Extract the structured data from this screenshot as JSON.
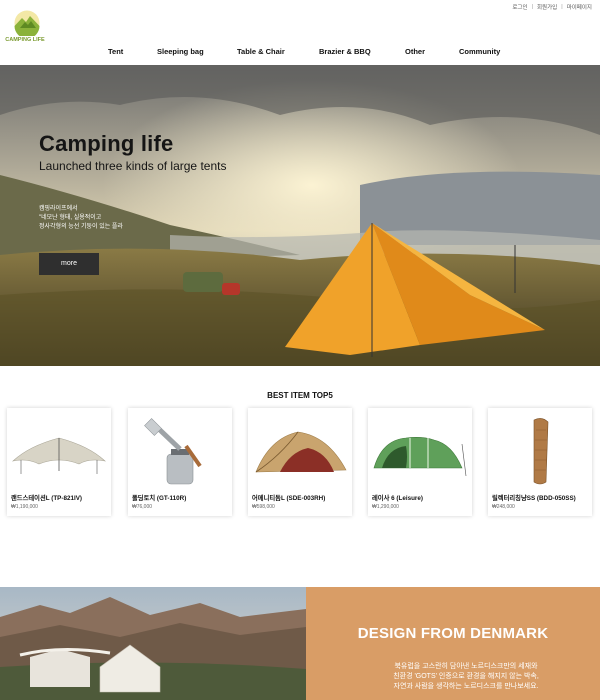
{
  "header": {
    "util_links": [
      "로그인",
      "회원가입",
      "마이페이지"
    ],
    "logo_text": "CAMPING LIFE",
    "nav": [
      "Tent",
      "Sleeping bag",
      "Table & Chair",
      "Brazier & BBQ",
      "Other",
      "Community"
    ]
  },
  "hero": {
    "title": "Camping life",
    "subtitle": "Launched three kinds of large tents",
    "desc_1": "캠핑라이프에서",
    "desc_2": "\"네모난 형태, 실용적이고",
    "desc_3": "정사각형의 능선 기둥이 있는 플라",
    "more_label": "more"
  },
  "best": {
    "title": "BEST ITEM TOP5",
    "items": [
      {
        "name": "랜드스테이션L (TP-821IV)",
        "price": "₩1,190,000"
      },
      {
        "name": "폴딩토치 (GT-110R)",
        "price": "₩76,000"
      },
      {
        "name": "어메니티돔L (SDE-003RH)",
        "price": "₩598,000"
      },
      {
        "name": "레이사 6 (Leisure)",
        "price": "₩1,290,000"
      },
      {
        "name": "릴렉터리칭냥SS (BDD-050SS)",
        "price": "₩248,000"
      }
    ]
  },
  "denmark": {
    "title": "DESIGN FROM DENMARK",
    "line_1": "북유럽을 고스란히 담아낸 노르디스크만의 세재와",
    "line_2": "친환경 'GOTS' 인증으로 환경을 해지지 않는 박속,",
    "line_3": "자연과 사람을 생각하는 노르디스크를 만나보세요."
  },
  "colors": {
    "accent": "#d99d66",
    "tent_orange": "#f0a22a",
    "logo_green": "#7a9a2e",
    "button_dark": "#2f2f2f"
  }
}
